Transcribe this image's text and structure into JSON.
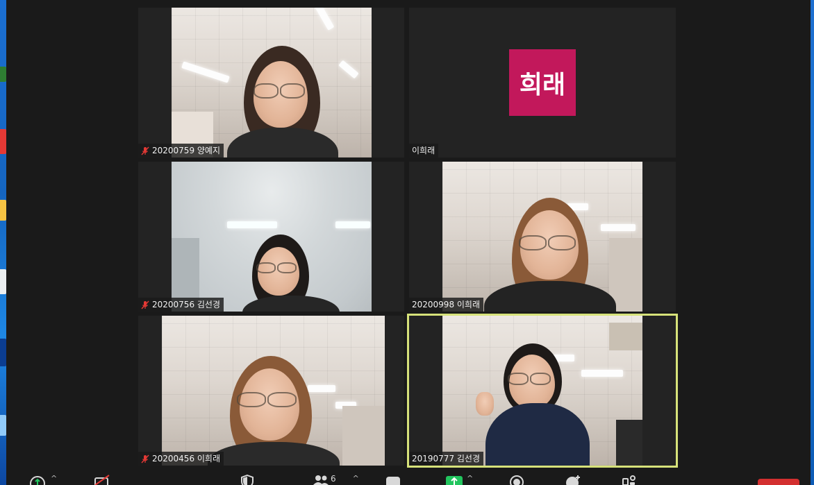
{
  "participants": [
    {
      "name": "20200759 양예지",
      "muted": true,
      "type": "video"
    },
    {
      "name": "이희래",
      "muted": false,
      "type": "avatar",
      "avatar_text": "희래"
    },
    {
      "name": "20200756 김선경",
      "muted": true,
      "type": "video"
    },
    {
      "name": "20200998 이희래",
      "muted": false,
      "type": "video"
    },
    {
      "name": "20200456 이희래",
      "muted": true,
      "type": "video"
    },
    {
      "name": "20190777 김선경",
      "muted": false,
      "type": "video",
      "active_speaker": true
    }
  ],
  "toolbar": {
    "participants_count": "6",
    "items": [
      "audio-icon",
      "video-off-icon",
      "security-icon",
      "participants-icon",
      "chat-icon",
      "share-screen-icon",
      "record-icon",
      "reactions-icon",
      "apps-icon",
      "leave-button"
    ]
  },
  "colors": {
    "background": "#1a1a1a",
    "tile": "#232323",
    "avatar": "#c2185b",
    "active_speaker_border": "#d7e27a",
    "share_green": "#22c55e",
    "leave_red": "#d32f2f",
    "mute_red": "#e53935"
  }
}
